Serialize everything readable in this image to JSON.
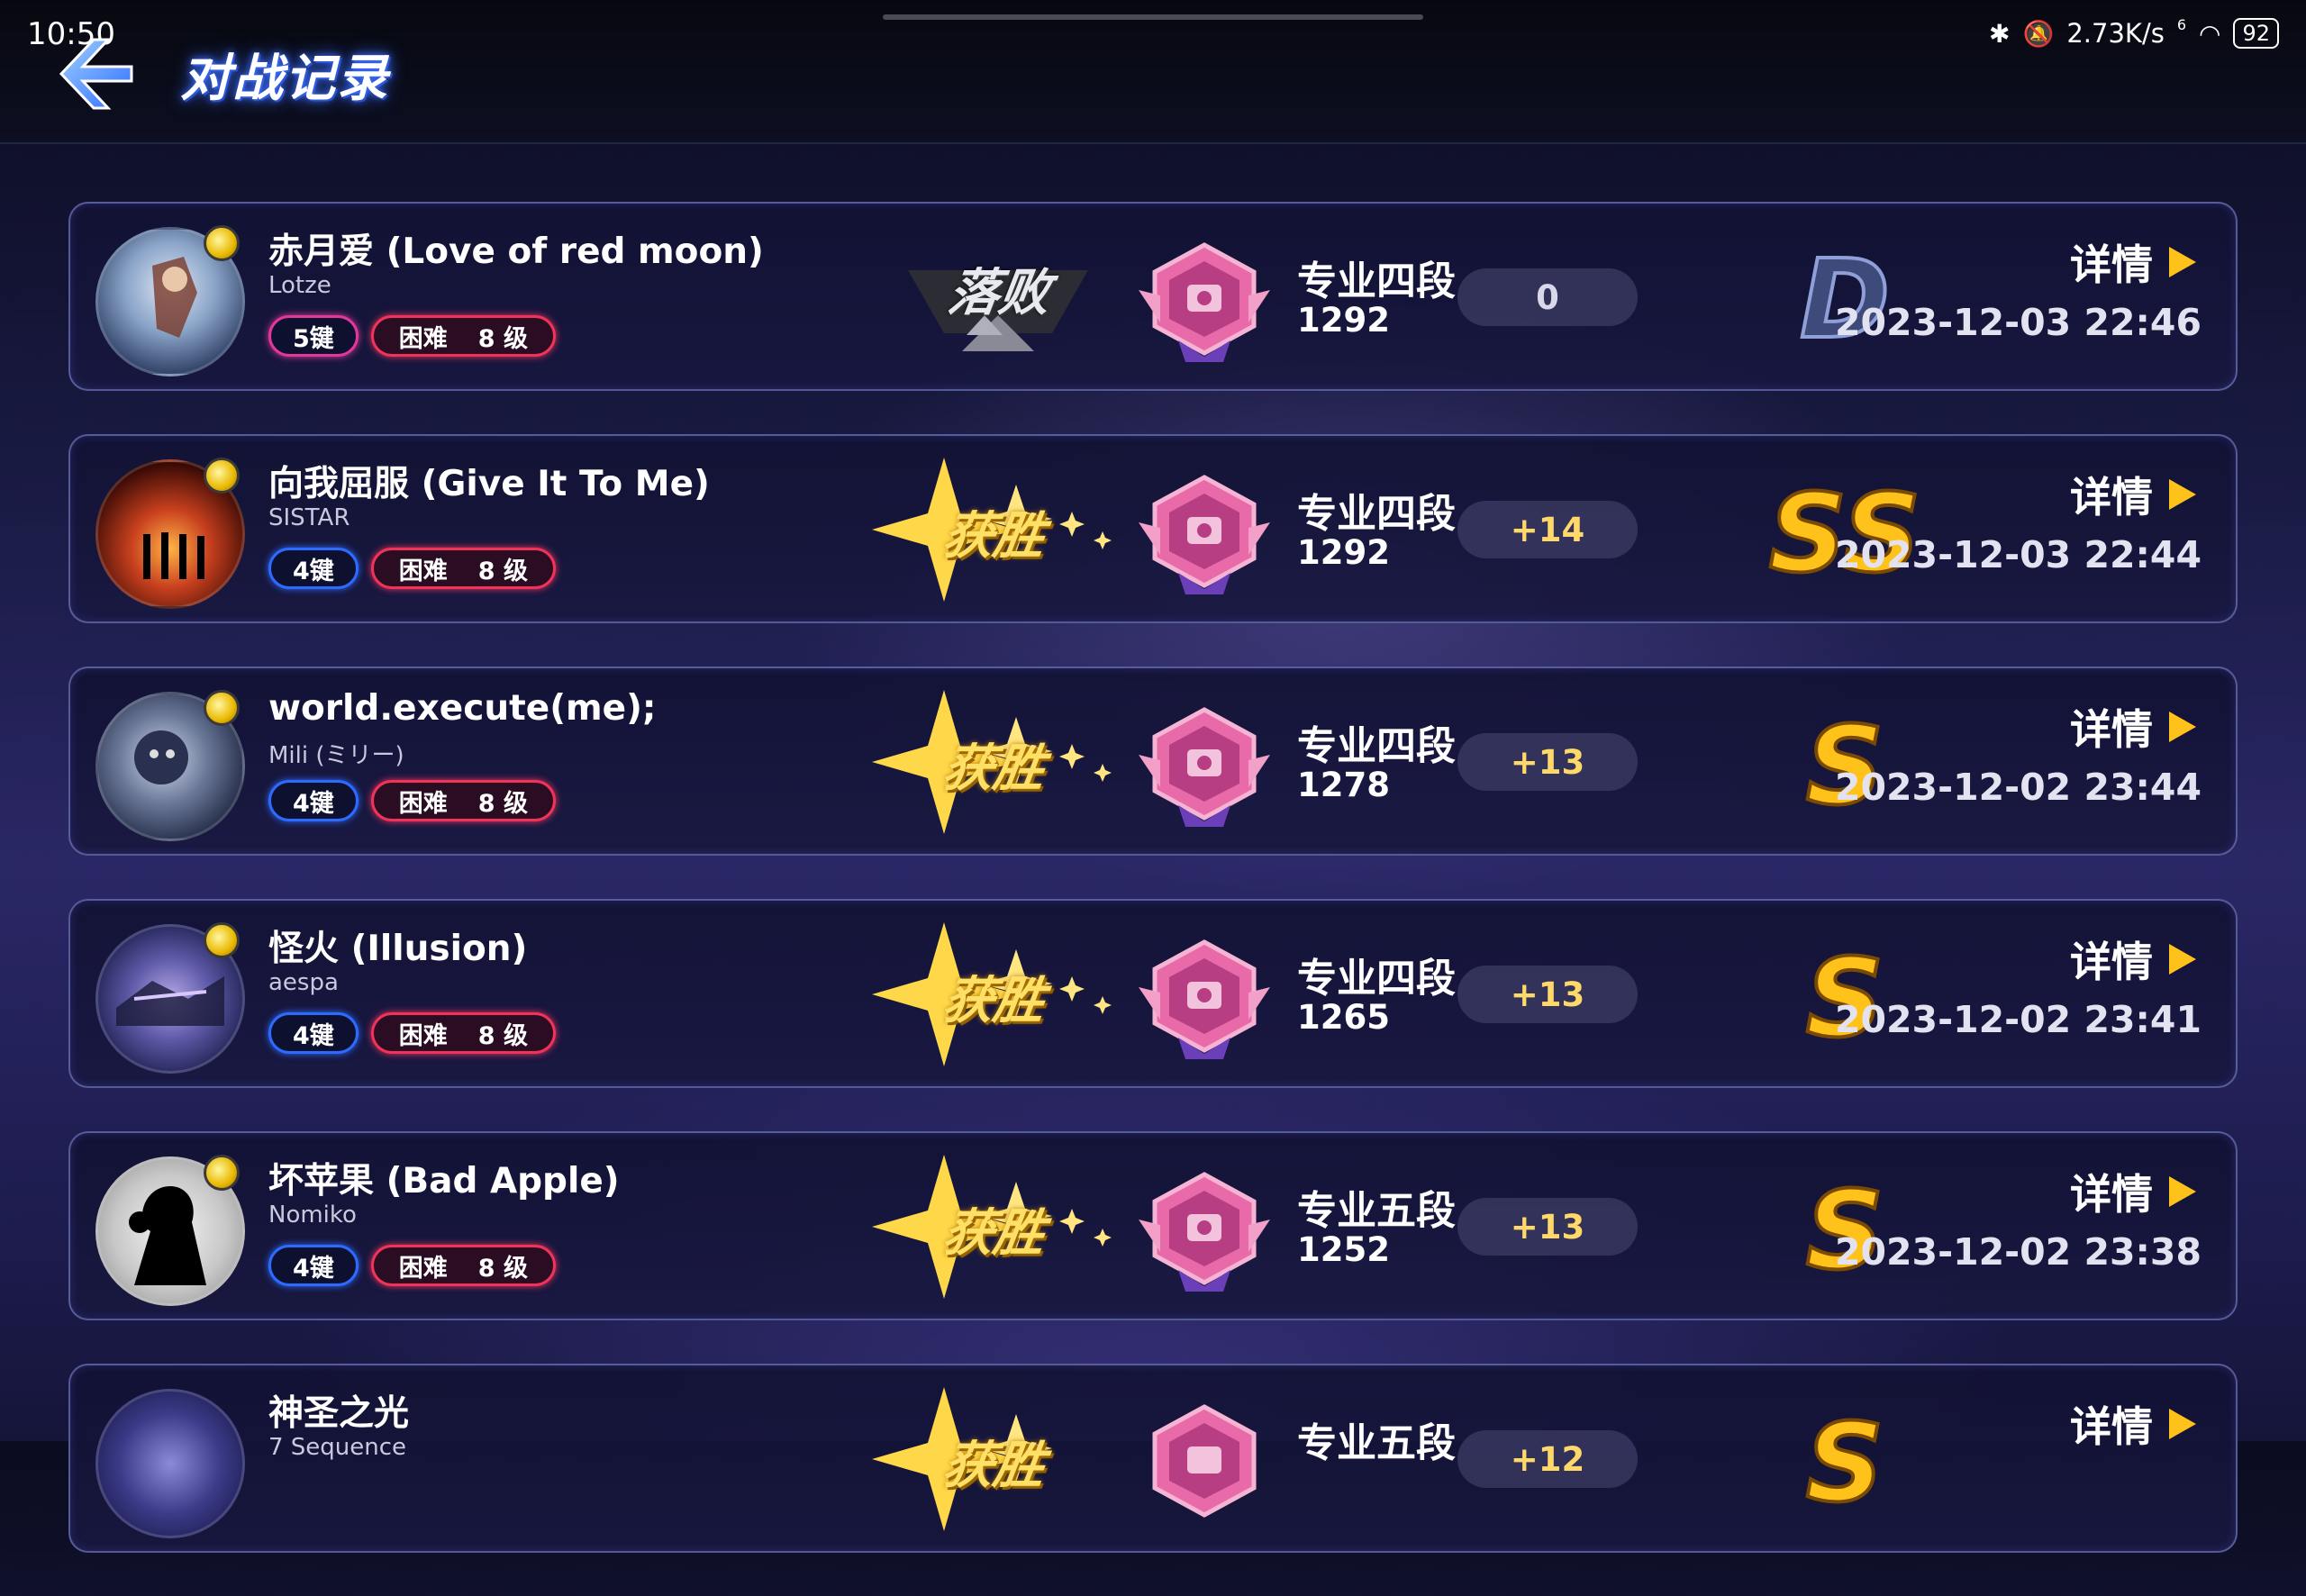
{
  "status_bar": {
    "time": "10:50",
    "icons": [
      "bluetooth-icon",
      "mute-icon",
      "wifi-icon"
    ],
    "network_speed": "2.73K/s",
    "wifi_gen": "6",
    "battery": "92"
  },
  "header": {
    "title": "对战记录",
    "back_icon": "back-arrow-icon"
  },
  "records": [
    {
      "title": "赤月爱 (Love of red moon)",
      "artist": "Lotze",
      "keys": "5键",
      "keys_variant": "k5",
      "difficulty": "困难",
      "level": "8 级",
      "result": "落败",
      "result_type": "lose",
      "rank": "专业四段",
      "rank_numeral": "IV",
      "score": "1292",
      "delta": "0",
      "delta_type": "neutral",
      "grade": "D",
      "details": "详情",
      "time": "2023-12-03 22:46"
    },
    {
      "title": "向我屈服 (Give It To Me)",
      "artist": "SISTAR",
      "keys": "4键",
      "keys_variant": "k4",
      "difficulty": "困难",
      "level": "8 级",
      "result": "获胜",
      "result_type": "win",
      "rank": "专业四段",
      "rank_numeral": "IV",
      "score": "1292",
      "delta": "+14",
      "delta_type": "gain",
      "grade": "SS",
      "details": "详情",
      "time": "2023-12-03 22:44"
    },
    {
      "title": "world.execute(me);",
      "artist": "Mili (ミリー)",
      "keys": "4键",
      "keys_variant": "k4",
      "difficulty": "困难",
      "level": "8 级",
      "result": "获胜",
      "result_type": "win",
      "rank": "专业四段",
      "rank_numeral": "IV",
      "score": "1278",
      "delta": "+13",
      "delta_type": "gain",
      "grade": "S",
      "details": "详情",
      "time": "2023-12-02 23:44"
    },
    {
      "title": "怪火 (Illusion)",
      "artist": "aespa",
      "keys": "4键",
      "keys_variant": "k4",
      "difficulty": "困难",
      "level": "8 级",
      "result": "获胜",
      "result_type": "win",
      "rank": "专业四段",
      "rank_numeral": "IV",
      "score": "1265",
      "delta": "+13",
      "delta_type": "gain",
      "grade": "S",
      "details": "详情",
      "time": "2023-12-02 23:41"
    },
    {
      "title": "坏苹果 (Bad Apple)",
      "artist": "Nomiko",
      "keys": "4键",
      "keys_variant": "k4",
      "difficulty": "困难",
      "level": "8 级",
      "result": "获胜",
      "result_type": "win",
      "rank": "专业五段",
      "rank_numeral": "V",
      "score": "1252",
      "delta": "+13",
      "delta_type": "gain",
      "grade": "S",
      "details": "详情",
      "time": "2023-12-02 23:38"
    },
    {
      "title": "神圣之光",
      "artist": "7 Sequence",
      "keys": "",
      "keys_variant": "k4",
      "difficulty": "",
      "level": "",
      "result": "获胜",
      "result_type": "win",
      "rank": "专业五段",
      "rank_numeral": "",
      "score": "",
      "delta": "+12",
      "delta_type": "gain",
      "grade": "S",
      "details": "详情",
      "time": ""
    }
  ],
  "colors": {
    "accent_gold": "#ffc21a",
    "keys_4": "#2d6bff",
    "keys_5": "#e0389b",
    "difficulty": "#f0335a",
    "win_text": "#ffe066"
  }
}
